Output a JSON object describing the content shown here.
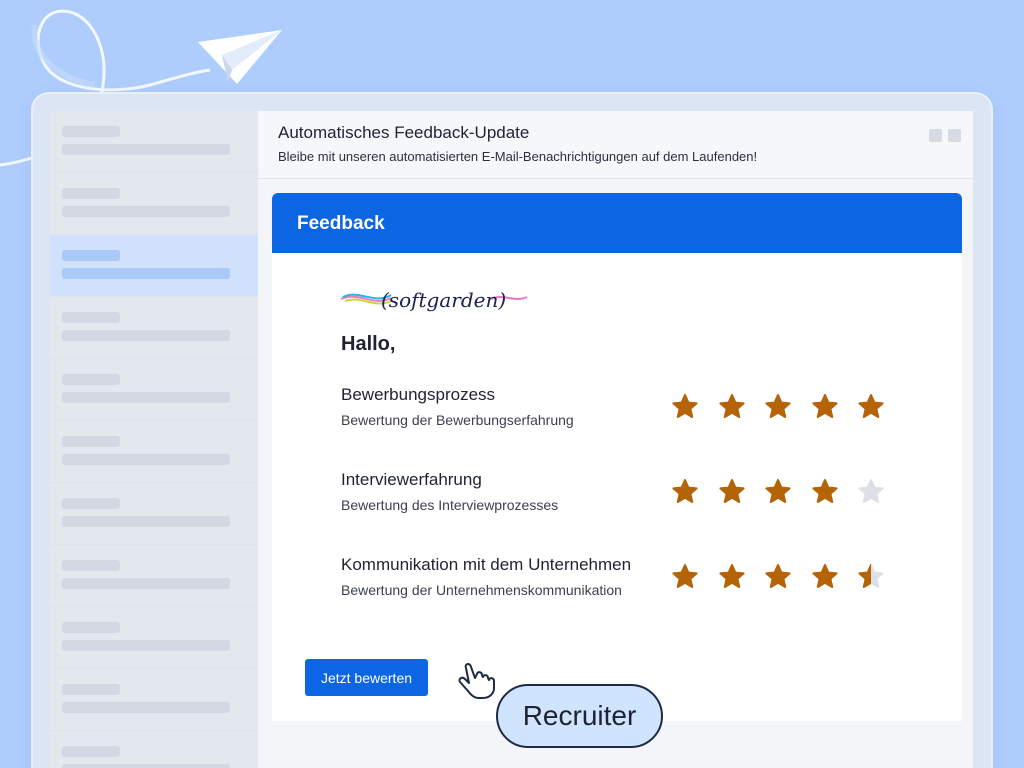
{
  "email": {
    "title": "Automatisches Feedback-Update",
    "subtitle": "Bleibe mit unseren automatisierten E-Mail-Benachrichtigungen auf dem Laufenden!"
  },
  "card": {
    "header": "Feedback",
    "logo_text": "(softgarden)",
    "greeting": "Hallo,",
    "ratings": [
      {
        "title": "Bewerbungsprozess",
        "description": "Bewertung der Bewerbungserfahrung",
        "score": 5,
        "max": 5
      },
      {
        "title": "Interviewerfahrung",
        "description": "Bewertung des Interviewprozesses",
        "score": 4,
        "max": 5
      },
      {
        "title": "Kommunikation mit dem Unternehmen",
        "description": "Bewertung der Unternehmenskommunikation",
        "score": 4.5,
        "max": 5
      }
    ],
    "cta_label": "Jetzt bewerten"
  },
  "badge": {
    "label": "Recruiter"
  },
  "sidebar": {
    "item_count": 11,
    "active_index": 2
  },
  "colors": {
    "background": "#aecdfd",
    "accent": "#0c66e4",
    "star_filled": "#b46306",
    "star_empty": "#dde1e7"
  },
  "icons": {
    "plane": "paper-plane-icon",
    "pointer": "hand-pointer-icon",
    "star": "star-icon"
  }
}
